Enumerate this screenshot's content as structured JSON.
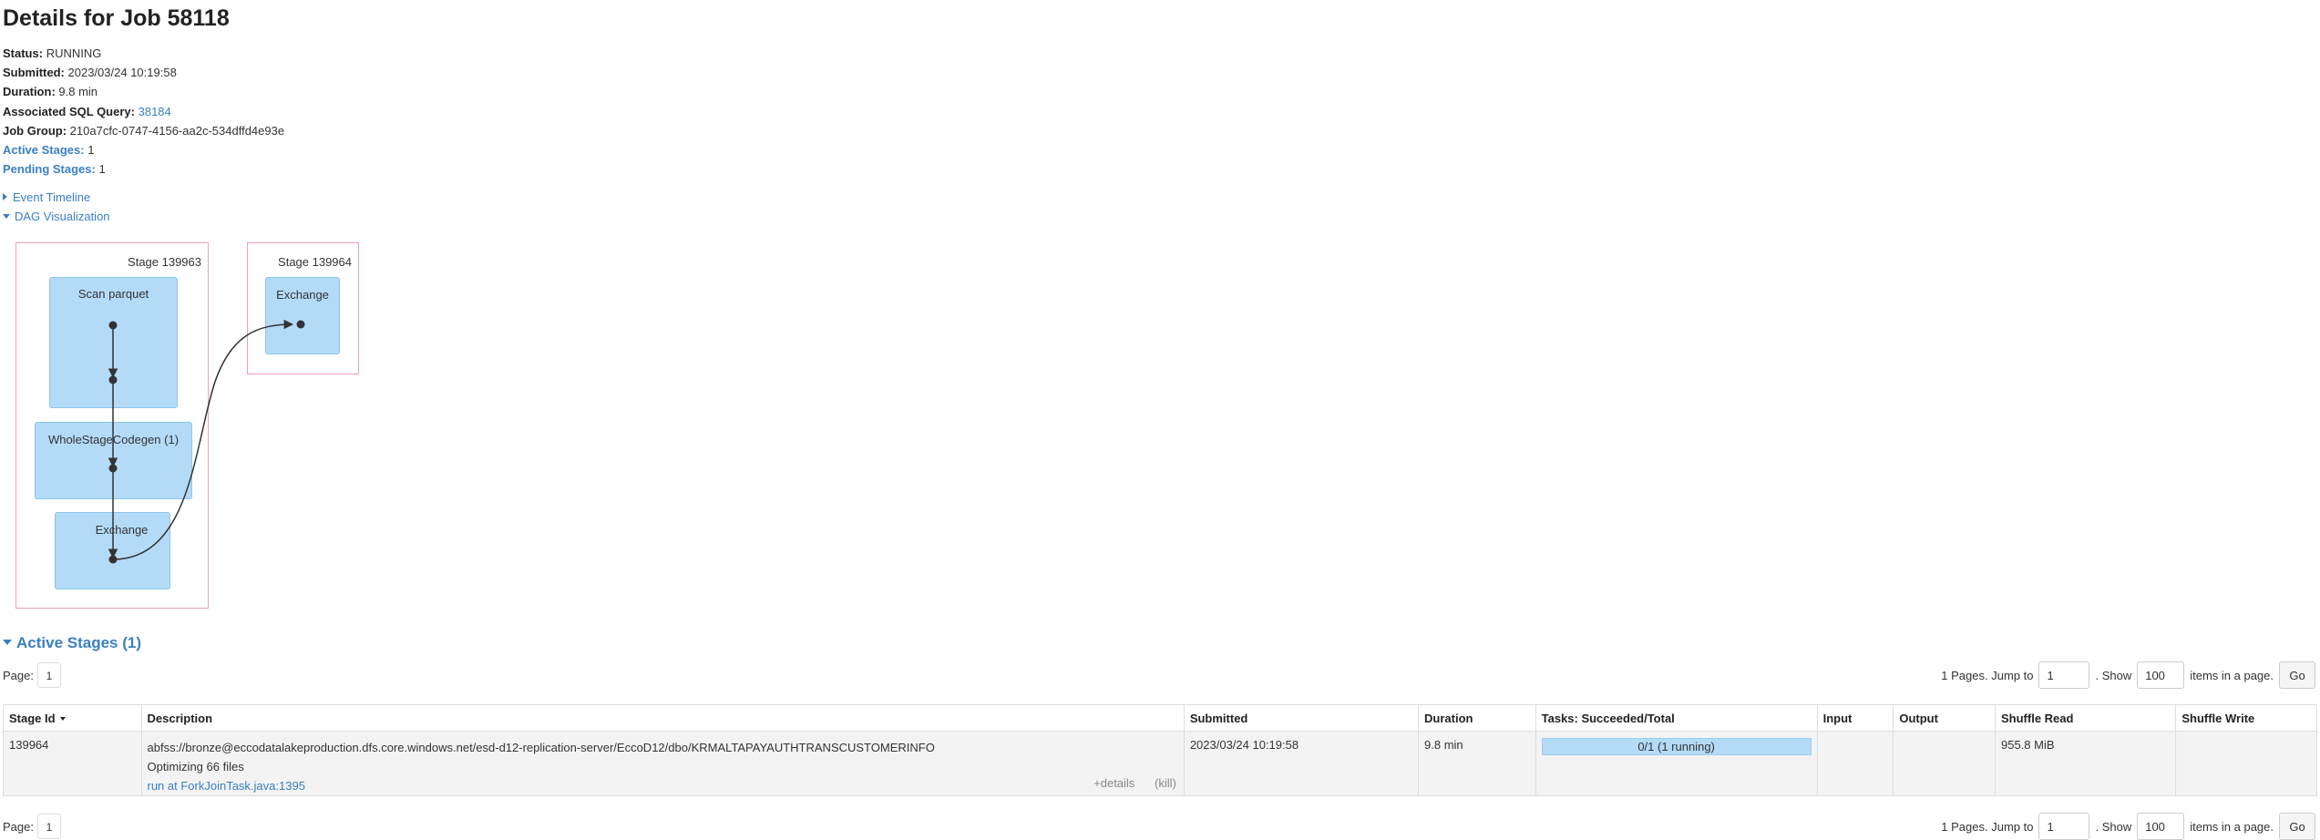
{
  "page": {
    "title": "Details for Job 58118"
  },
  "summary": {
    "status_label": "Status:",
    "status_value": "RUNNING",
    "submitted_label": "Submitted:",
    "submitted_value": "2023/03/24 10:19:58",
    "duration_label": "Duration:",
    "duration_value": "9.8 min",
    "sql_label": "Associated SQL Query:",
    "sql_value": "38184",
    "group_label": "Job Group:",
    "group_value": "210a7cfc-0747-4156-aa2c-534dffd4e93e",
    "active_label": "Active Stages:",
    "active_value": "1",
    "pending_label": "Pending Stages:",
    "pending_value": "1"
  },
  "toggles": {
    "event_timeline": "Event Timeline",
    "dag_visualization": "DAG Visualization"
  },
  "dag": {
    "stages": [
      {
        "label": "Stage 139963",
        "nodes": [
          "Scan parquet",
          "WholeStageCodegen (1)",
          "Exchange"
        ]
      },
      {
        "label": "Stage 139964",
        "nodes": [
          "Exchange"
        ]
      }
    ]
  },
  "active_stages": {
    "heading": "Active Stages (1)",
    "pager_top": {
      "page_label": "Page:",
      "current_page": "1",
      "pages_text": "1 Pages. Jump to",
      "jump_value": "1",
      "show_text": ". Show",
      "show_value": "100",
      "items_text": "items in a page.",
      "go_label": "Go"
    },
    "pager_bottom": {
      "page_label": "Page:",
      "current_page": "1",
      "pages_text": "1 Pages. Jump to",
      "jump_value": "1",
      "show_text": ". Show",
      "show_value": "100",
      "items_text": "items in a page.",
      "go_label": "Go"
    },
    "columns": [
      "Stage Id",
      "Description",
      "Submitted",
      "Duration",
      "Tasks: Succeeded/Total",
      "Input",
      "Output",
      "Shuffle Read",
      "Shuffle Write"
    ],
    "rows": [
      {
        "stage_id": "139964",
        "description_path": "abfss://bronze@eccodatalakeproduction.dfs.core.windows.net/esd-d12-replication-server/EccoD12/dbo/KRMALTAPAYAUTHTRANSCUSTOMERINFO",
        "description_note": "Optimizing 66 files",
        "description_link": "run at ForkJoinTask.java:1395",
        "details_label": "+details",
        "kill_label": "(kill)",
        "submitted": "2023/03/24 10:19:58",
        "duration": "9.8 min",
        "tasks_text": "0/1 (1 running)",
        "tasks_fraction": 0,
        "input": "",
        "output": "",
        "shuffle_read": "955.8 MiB",
        "shuffle_write": ""
      }
    ]
  },
  "colors": {
    "link": "#3a7fc4",
    "node_fill": "#b3dbf8",
    "stage_border": "#e7a4b3",
    "progress_running": "#b3dbf8"
  }
}
